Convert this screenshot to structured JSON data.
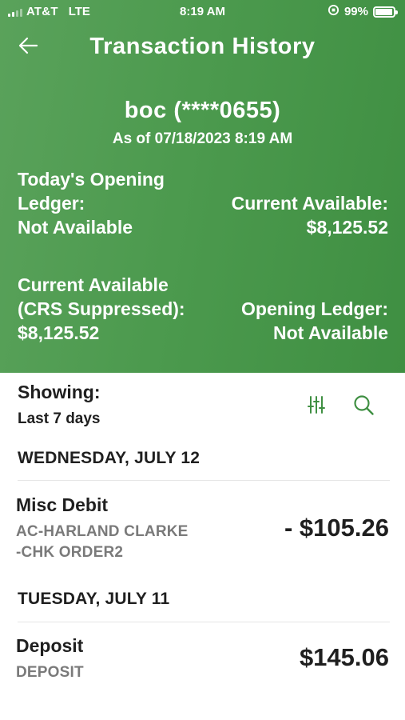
{
  "status_bar": {
    "carrier": "AT&T",
    "network": "LTE",
    "time": "8:19 AM",
    "battery": "99%",
    "battery_level": 0.99,
    "signal_bars": 2
  },
  "header": {
    "title": "Transaction History",
    "account_name": "boc (****0655)",
    "as_of": "As of 07/18/2023 8:19 AM",
    "color": "#4c9a4e"
  },
  "balances": {
    "todays_opening_label_1": "Today's Opening",
    "todays_opening_label_2": "Ledger:",
    "todays_opening_value": "Not Available",
    "current_available_label": "Current Available:",
    "current_available_value": "$8,125.52",
    "crs_label_1": "Current Available",
    "crs_label_2": "(CRS Suppressed):",
    "crs_value": "$8,125.52",
    "opening_ledger_label": "Opening Ledger:",
    "opening_ledger_value": "Not Available"
  },
  "filter": {
    "label": "Showing:",
    "value": "Last 7 days",
    "filter_icon": "sliders-icon",
    "search_icon": "search-icon",
    "icon_color": "#3f8f42"
  },
  "days": [
    {
      "heading": "WEDNESDAY, JULY 12",
      "transactions": [
        {
          "name": "Misc Debit",
          "desc_1": "AC-HARLAND CLARKE",
          "desc_2": "-CHK ORDER2",
          "amount": "- $105.26"
        }
      ]
    },
    {
      "heading": "TUESDAY, JULY 11",
      "transactions": [
        {
          "name": "Deposit",
          "desc_1": "DEPOSIT",
          "amount": "$145.06"
        }
      ]
    }
  ]
}
